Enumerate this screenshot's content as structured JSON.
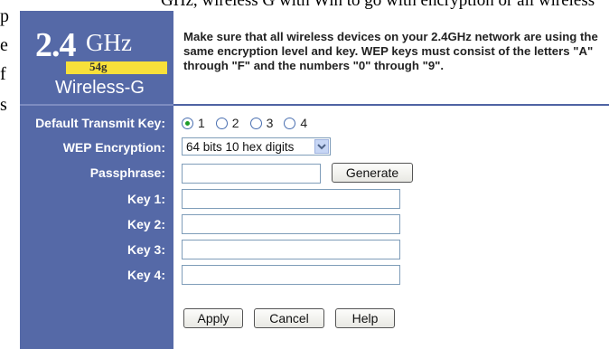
{
  "background_fragments": {
    "top_text": "GHz, wireless G with Win to go with encryption or all wireless",
    "left_letters": [
      "p",
      "e",
      "f",
      "s"
    ]
  },
  "logo": {
    "big_number": "2.4",
    "ghz": "GHz",
    "band": "54g",
    "product": "Wireless-G"
  },
  "description": "Make sure that all wireless devices on your 2.4GHz network are using the same encryption level and key. WEP keys must consist of the letters \"A\" through \"F\" and the numbers \"0\" through \"9\".",
  "form": {
    "default_key_label": "Default Transmit Key:",
    "default_key_options": [
      "1",
      "2",
      "3",
      "4"
    ],
    "default_key_selected": "1",
    "wep_label": "WEP Encryption:",
    "wep_value": "64 bits 10 hex digits",
    "passphrase_label": "Passphrase:",
    "passphrase_value": "",
    "generate_label": "Generate",
    "key1_label": "Key 1:",
    "key2_label": "Key 2:",
    "key3_label": "Key 3:",
    "key4_label": "Key 4:",
    "key1_value": "",
    "key2_value": "",
    "key3_value": "",
    "key4_value": ""
  },
  "buttons": {
    "apply": "Apply",
    "cancel": "Cancel",
    "help": "Help"
  },
  "colors": {
    "sidebar_blue": "#5569a7",
    "logo_yellow": "#f7e03a",
    "radio_selected": "#1f9d2a"
  },
  "icons": {
    "select_arrow": "chevron-down-icon"
  }
}
